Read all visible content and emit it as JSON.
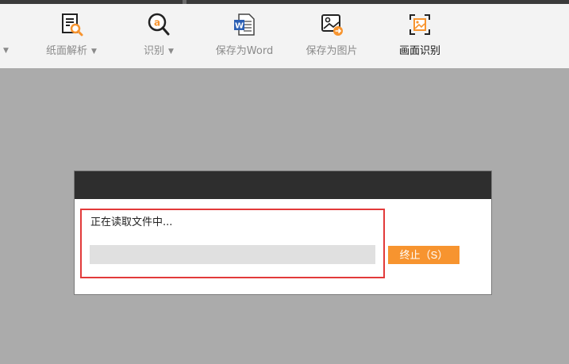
{
  "toolbar": {
    "tools": [
      {
        "label": "纸面解析",
        "icon": "paper-scan-icon",
        "has_dropdown": true,
        "active": false
      },
      {
        "label": "识别",
        "icon": "recognize-magnifier-icon",
        "has_dropdown": true,
        "active": false
      },
      {
        "label": "保存为Word",
        "icon": "word-document-icon",
        "has_dropdown": false,
        "active": false
      },
      {
        "label": "保存为图片",
        "icon": "save-image-icon",
        "has_dropdown": false,
        "active": false
      },
      {
        "label": "画面识别",
        "icon": "screen-capture-icon",
        "has_dropdown": false,
        "active": true
      }
    ],
    "dropdown_glyph": "▼"
  },
  "dialog": {
    "status_text": "正在读取文件中...",
    "progress": 0,
    "stop_label": "终止（S）"
  },
  "colors": {
    "accent": "#f7942f",
    "titlebar": "#2e2e2e",
    "background": "#ababab",
    "highlight": "#e23a3a"
  }
}
